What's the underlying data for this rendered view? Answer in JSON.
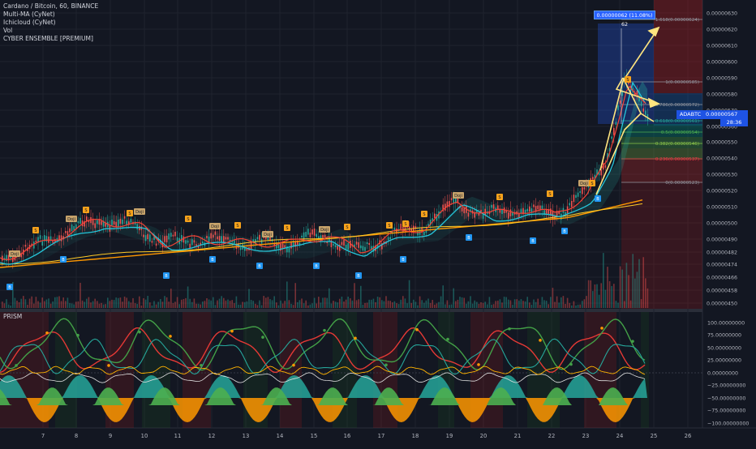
{
  "legend": {
    "title": "Cardano / Bitcoin, 60, BINANCE",
    "lines": [
      "Multi-MA (CyNet)",
      "Ichicloud (CyNet)",
      "Vol",
      "CYBER ENSEMBLE [PREMIUM]"
    ]
  },
  "oscillator": {
    "name": "PRISM"
  },
  "price_axis": [
    "0.00000630",
    "0.00000620",
    "0.00000610",
    "0.00000600",
    "0.00000590",
    "0.00000580",
    "0.00000570",
    "0.00000560",
    "0.00000550",
    "0.00000540",
    "0.00000530",
    "0.00000520",
    "0.00000510",
    "0.00000500",
    "0.00000490",
    "0.00000482",
    "0.00000474",
    "0.00000466",
    "0.00000458",
    "0.00000450"
  ],
  "osc_axis": [
    "100.00000000",
    "75.00000000",
    "50.00000000",
    "25.00000000",
    "0.00000000",
    "−25.00000000",
    "−50.00000000",
    "−75.00000000",
    "−100.00000000"
  ],
  "time_axis": [
    "7",
    "8",
    "9",
    "10",
    "11",
    "12",
    "13",
    "14",
    "15",
    "16",
    "17",
    "18",
    "19",
    "20",
    "21",
    "22",
    "23",
    "24",
    "25",
    "26"
  ],
  "current": {
    "symbol": "ADABTC",
    "price": "0.00000567",
    "countdown": "28:36"
  },
  "measure_label": "0.00000062 (11.08%) 62",
  "fib_levels": [
    {
      "label": "1.618(0.00000624)",
      "color": "#9598a1"
    },
    {
      "label": "1(0.00000585)",
      "color": "#9598a1"
    },
    {
      "label": "0.786(0.00000572)",
      "color": "#9598a1"
    },
    {
      "label": "0.618(0.00000561)",
      "color": "#26a69a"
    },
    {
      "label": "0.5(0.00000554)",
      "color": "#4caf50"
    },
    {
      "label": "0.382(0.00000546)",
      "color": "#8bc34a"
    },
    {
      "label": "0.236(0.00000537)",
      "color": "#f23645"
    },
    {
      "label": "0(0.00000523)",
      "color": "#9598a1"
    }
  ],
  "signal_labels": {
    "doji": "Doji",
    "buy": "B",
    "sell": "S"
  },
  "colors": {
    "background": "#131722",
    "accent": "#2962ff",
    "up": "#26a69a",
    "down": "#ef5350",
    "ma_fast": "#f44336",
    "ma_mid": "#00bcd4",
    "ma_slow": "#ff9800",
    "signal_orange": "#f7a21b",
    "signal_blue": "#2196f3",
    "doji": "#c7a36b"
  }
}
